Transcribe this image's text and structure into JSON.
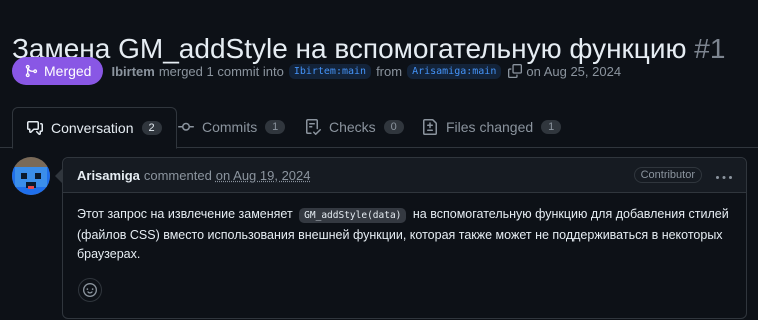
{
  "pr": {
    "title": "Замена GM_addStyle на вспомогательную функцию",
    "number": "#1",
    "status": "Merged",
    "author": "Ibirtem",
    "action": "merged 1 commit into",
    "base_branch": "Ibirtem:main",
    "from_label": "from",
    "head_branch": "Arisamiga:main",
    "date": "on Aug 25, 2024"
  },
  "tabs": [
    {
      "label": "Conversation",
      "count": "2",
      "icon": "comment-discussion-icon"
    },
    {
      "label": "Commits",
      "count": "1",
      "icon": "git-commit-icon"
    },
    {
      "label": "Checks",
      "count": "0",
      "icon": "checklist-icon"
    },
    {
      "label": "Files changed",
      "count": "1",
      "icon": "file-diff-icon"
    }
  ],
  "comment": {
    "author": "Arisamiga",
    "verb": "commented",
    "date": "on Aug 19, 2024",
    "role": "Contributor",
    "body_before": "Этот запрос на извлечение заменяет",
    "body_code": "GM_addStyle(data)",
    "body_after": "на вспомогательную функцию для добавления стилей (файлов CSS) вместо использования внешней функции, которая также может не поддерживаться в некоторых браузерах."
  },
  "colors": {
    "background": "#0d1117",
    "merged": "#8957e5",
    "accent": "#4493f8",
    "border": "#30363d"
  }
}
